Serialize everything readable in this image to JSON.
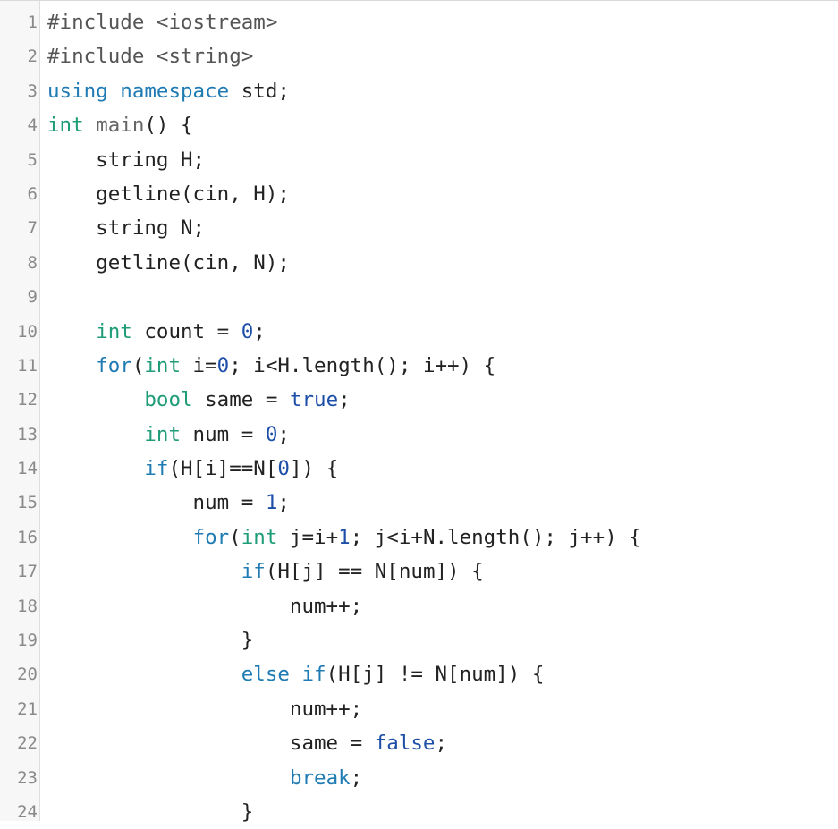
{
  "colors": {
    "keyword": "#1f7bb3",
    "type": "#1f9c78",
    "literal": "#1e4fa8",
    "text": "#222222",
    "line_number": "#8a8a8a",
    "gutter_bg": "#f7f7f7"
  },
  "code_lines": [
    {
      "n": "1",
      "tokens": [
        {
          "t": "#include <iostream>",
          "c": "pre"
        }
      ]
    },
    {
      "n": "2",
      "tokens": [
        {
          "t": "#include <string>",
          "c": "pre"
        }
      ]
    },
    {
      "n": "3",
      "tokens": [
        {
          "t": "using",
          "c": "kw"
        },
        {
          "t": " "
        },
        {
          "t": "namespace",
          "c": "kw"
        },
        {
          "t": " std;"
        }
      ]
    },
    {
      "n": "4",
      "tokens": [
        {
          "t": "int",
          "c": "ty"
        },
        {
          "t": " "
        },
        {
          "t": "main",
          "c": "fn"
        },
        {
          "t": "() {"
        }
      ]
    },
    {
      "n": "5",
      "tokens": [
        {
          "t": "    string H;"
        }
      ]
    },
    {
      "n": "6",
      "tokens": [
        {
          "t": "    getline(cin, H);"
        }
      ]
    },
    {
      "n": "7",
      "tokens": [
        {
          "t": "    string N;"
        }
      ]
    },
    {
      "n": "8",
      "tokens": [
        {
          "t": "    getline(cin, N);"
        }
      ]
    },
    {
      "n": "9",
      "tokens": [
        {
          "t": ""
        }
      ]
    },
    {
      "n": "10",
      "tokens": [
        {
          "t": "    "
        },
        {
          "t": "int",
          "c": "ty"
        },
        {
          "t": " count = "
        },
        {
          "t": "0",
          "c": "num"
        },
        {
          "t": ";"
        }
      ]
    },
    {
      "n": "11",
      "tokens": [
        {
          "t": "    "
        },
        {
          "t": "for",
          "c": "kw"
        },
        {
          "t": "("
        },
        {
          "t": "int",
          "c": "ty"
        },
        {
          "t": " i="
        },
        {
          "t": "0",
          "c": "num"
        },
        {
          "t": "; i<H.length(); i++) {"
        }
      ]
    },
    {
      "n": "12",
      "tokens": [
        {
          "t": "        "
        },
        {
          "t": "bool",
          "c": "ty"
        },
        {
          "t": " same = "
        },
        {
          "t": "true",
          "c": "lit"
        },
        {
          "t": ";"
        }
      ]
    },
    {
      "n": "13",
      "tokens": [
        {
          "t": "        "
        },
        {
          "t": "int",
          "c": "ty"
        },
        {
          "t": " num = "
        },
        {
          "t": "0",
          "c": "num"
        },
        {
          "t": ";"
        }
      ]
    },
    {
      "n": "14",
      "tokens": [
        {
          "t": "        "
        },
        {
          "t": "if",
          "c": "kw"
        },
        {
          "t": "(H[i]==N["
        },
        {
          "t": "0",
          "c": "num"
        },
        {
          "t": "]) {"
        }
      ]
    },
    {
      "n": "15",
      "tokens": [
        {
          "t": "            num = "
        },
        {
          "t": "1",
          "c": "num"
        },
        {
          "t": ";"
        }
      ]
    },
    {
      "n": "16",
      "tokens": [
        {
          "t": "            "
        },
        {
          "t": "for",
          "c": "kw"
        },
        {
          "t": "("
        },
        {
          "t": "int",
          "c": "ty"
        },
        {
          "t": " j=i+"
        },
        {
          "t": "1",
          "c": "num"
        },
        {
          "t": "; j<i+N.length(); j++) {"
        }
      ]
    },
    {
      "n": "17",
      "tokens": [
        {
          "t": "                "
        },
        {
          "t": "if",
          "c": "kw"
        },
        {
          "t": "(H[j] == N[num]) {"
        }
      ]
    },
    {
      "n": "18",
      "tokens": [
        {
          "t": "                    num++;"
        }
      ]
    },
    {
      "n": "19",
      "tokens": [
        {
          "t": "                }"
        }
      ]
    },
    {
      "n": "20",
      "tokens": [
        {
          "t": "                "
        },
        {
          "t": "else",
          "c": "kw"
        },
        {
          "t": " "
        },
        {
          "t": "if",
          "c": "kw"
        },
        {
          "t": "(H[j] != N[num]) {"
        }
      ]
    },
    {
      "n": "21",
      "tokens": [
        {
          "t": "                    num++;"
        }
      ]
    },
    {
      "n": "22",
      "tokens": [
        {
          "t": "                    same = "
        },
        {
          "t": "false",
          "c": "lit"
        },
        {
          "t": ";"
        }
      ]
    },
    {
      "n": "23",
      "tokens": [
        {
          "t": "                    "
        },
        {
          "t": "break",
          "c": "kw"
        },
        {
          "t": ";"
        }
      ]
    },
    {
      "n": "24",
      "tokens": [
        {
          "t": "                }"
        }
      ]
    }
  ]
}
